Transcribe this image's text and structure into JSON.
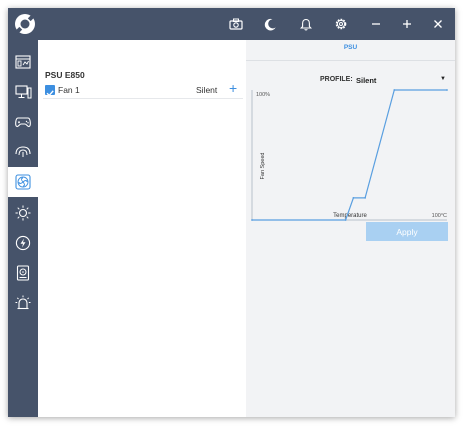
{
  "titlebar": {
    "buttons": [
      "camera-icon",
      "moon-icon",
      "bell-icon",
      "gear-icon",
      "minimize-icon",
      "maximize-icon",
      "close-icon"
    ]
  },
  "sidebar": {
    "items": [
      {
        "icon": "dashboard-icon",
        "active": false
      },
      {
        "icon": "monitor-icon",
        "active": false
      },
      {
        "icon": "gamepad-icon",
        "active": false
      },
      {
        "icon": "mouse-icon",
        "active": false
      },
      {
        "icon": "fan-icon",
        "active": true
      },
      {
        "icon": "lighting-icon",
        "active": false
      },
      {
        "icon": "power-icon",
        "active": false
      },
      {
        "icon": "storage-icon",
        "active": false
      },
      {
        "icon": "alarm-light-icon",
        "active": false
      }
    ]
  },
  "device": {
    "title": "PSU E850",
    "fans": [
      {
        "name": "Fan 1",
        "profile": "Silent",
        "checked": true
      }
    ],
    "add_label": "+"
  },
  "right": {
    "tab": "PSU",
    "profile_label": "PROFILE:",
    "profile_value": "Silent",
    "caret": "▼",
    "apply_label": "Apply"
  },
  "chart_data": {
    "type": "line",
    "x": [
      0,
      48,
      52,
      58,
      73,
      100
    ],
    "y": [
      0,
      0,
      17,
      17,
      100,
      100
    ],
    "xlim": [
      0,
      100
    ],
    "ylim": [
      0,
      100
    ],
    "xlabel": "Temperature",
    "ylabel": "Fan Speed",
    "y_max_label": "100%",
    "x_max_label": "100°C",
    "grid": false
  },
  "colors": {
    "accent": "#3d8fe0",
    "chrome": "#46536a",
    "apply_disabled": "#a9d0f2"
  }
}
